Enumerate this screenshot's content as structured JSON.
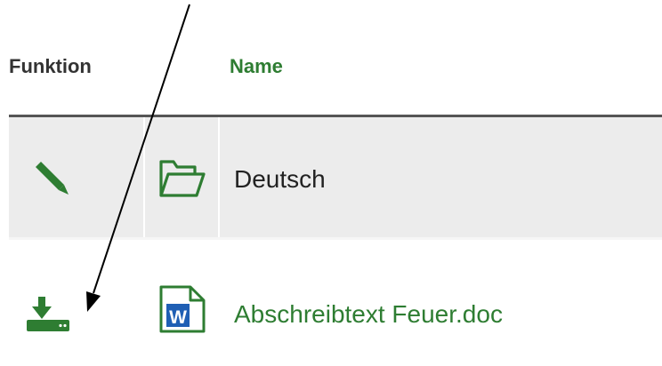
{
  "table": {
    "columns": {
      "function": "Funktion",
      "name": "Name"
    },
    "rows": [
      {
        "type": "folder",
        "name": "Deutsch",
        "function_icon": "pencil-icon",
        "type_icon": "folder-icon"
      },
      {
        "type": "file",
        "name": "Abschreibtext Feuer.doc",
        "function_icon": "download-icon",
        "type_icon": "word-document-icon",
        "type_icon_letter": "W"
      }
    ]
  },
  "colors": {
    "accent": "#2e7d32",
    "header_text": "#333333",
    "row_highlight": "#ececec",
    "annotation_arrow": "#000000"
  }
}
